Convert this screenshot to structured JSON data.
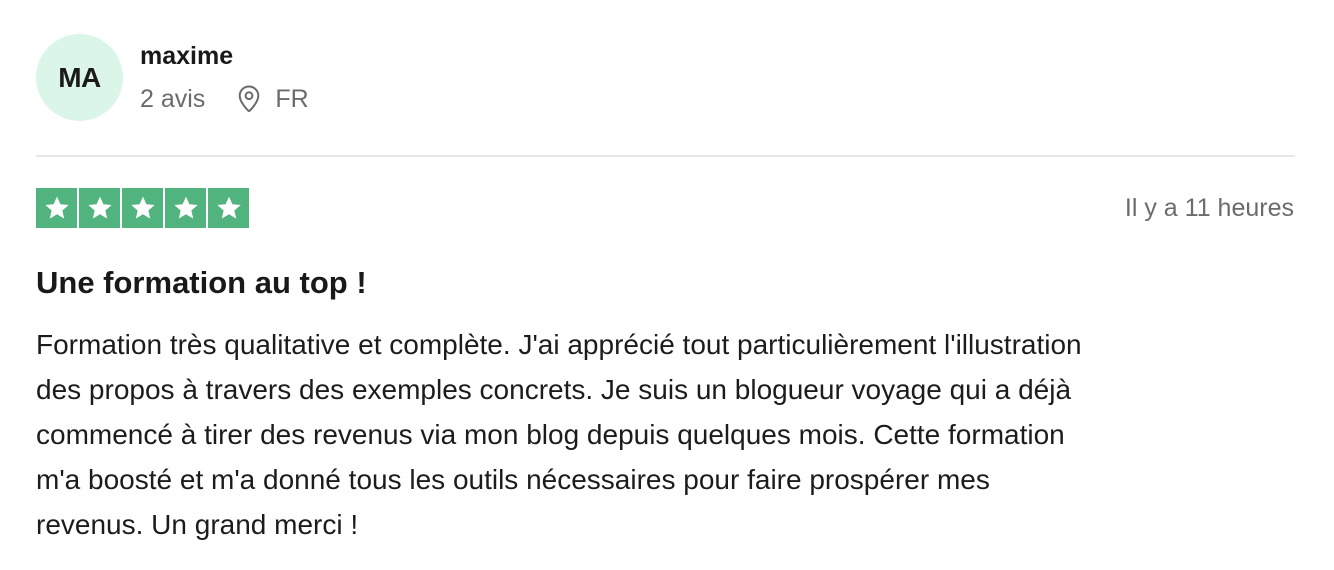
{
  "reviewer": {
    "initials": "MA",
    "name": "maxime",
    "reviews_count": "2 avis",
    "country": "FR",
    "avatar_bg": "#dcf5e9"
  },
  "rating": {
    "stars": 5,
    "max_stars": 5,
    "star_bg": "#51b47e",
    "star_color": "#ffffff"
  },
  "review": {
    "time": "Il y a 11 heures",
    "title": "Une formation au top !",
    "body_lines": [
      "Formation très qualitative et complète. J'ai apprécié tout particulièrement l'illustration",
      "des propos à travers des exemples concrets. Je suis un blogueur voyage qui a déjà",
      "commencé à tirer des revenus via mon blog depuis quelques mois. Cette formation",
      "m'a boosté et m'a donné tous les outils nécessaires pour faire prospérer mes",
      "revenus. Un grand merci !"
    ]
  },
  "icons": {
    "location": "map-pin-icon",
    "star": "star-icon"
  }
}
